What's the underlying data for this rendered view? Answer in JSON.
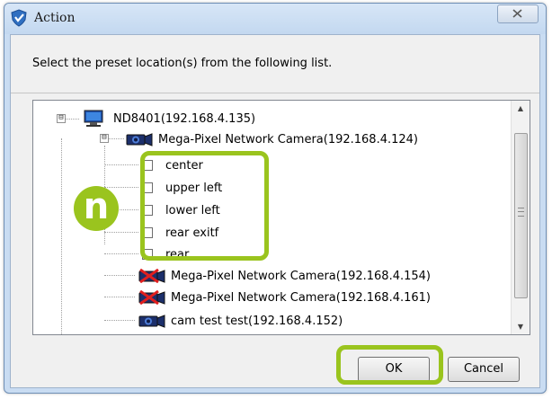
{
  "window": {
    "title": "Action"
  },
  "dialog": {
    "instruction": "Select the preset location(s) from the following list."
  },
  "tree": {
    "root": {
      "label": "ND8401(192.168.4.135)",
      "icon": "computer-icon",
      "expander": "⊟"
    },
    "camera_expanded": {
      "label": "Mega-Pixel Network Camera(192.168.4.124)",
      "icon": "camera-icon",
      "expander": "⊟"
    },
    "presets": [
      {
        "label": "center",
        "checked": false
      },
      {
        "label": "upper left",
        "checked": false
      },
      {
        "label": "lower left",
        "checked": false
      },
      {
        "label": "rear exitf",
        "checked": false
      },
      {
        "label": "rear",
        "checked": false
      }
    ],
    "other_cameras": [
      {
        "label": "Mega-Pixel Network Camera(192.168.4.154)",
        "icon": "camera-disconnected-icon"
      },
      {
        "label": "Mega-Pixel Network Camera(192.168.4.161)",
        "icon": "camera-disconnected-icon"
      },
      {
        "label": "cam test test(192.168.4.152)",
        "icon": "camera-icon"
      }
    ]
  },
  "annotation": {
    "badge_letter": "n",
    "accent_color": "#9ac41e"
  },
  "buttons": {
    "ok": "OK",
    "cancel": "Cancel"
  }
}
